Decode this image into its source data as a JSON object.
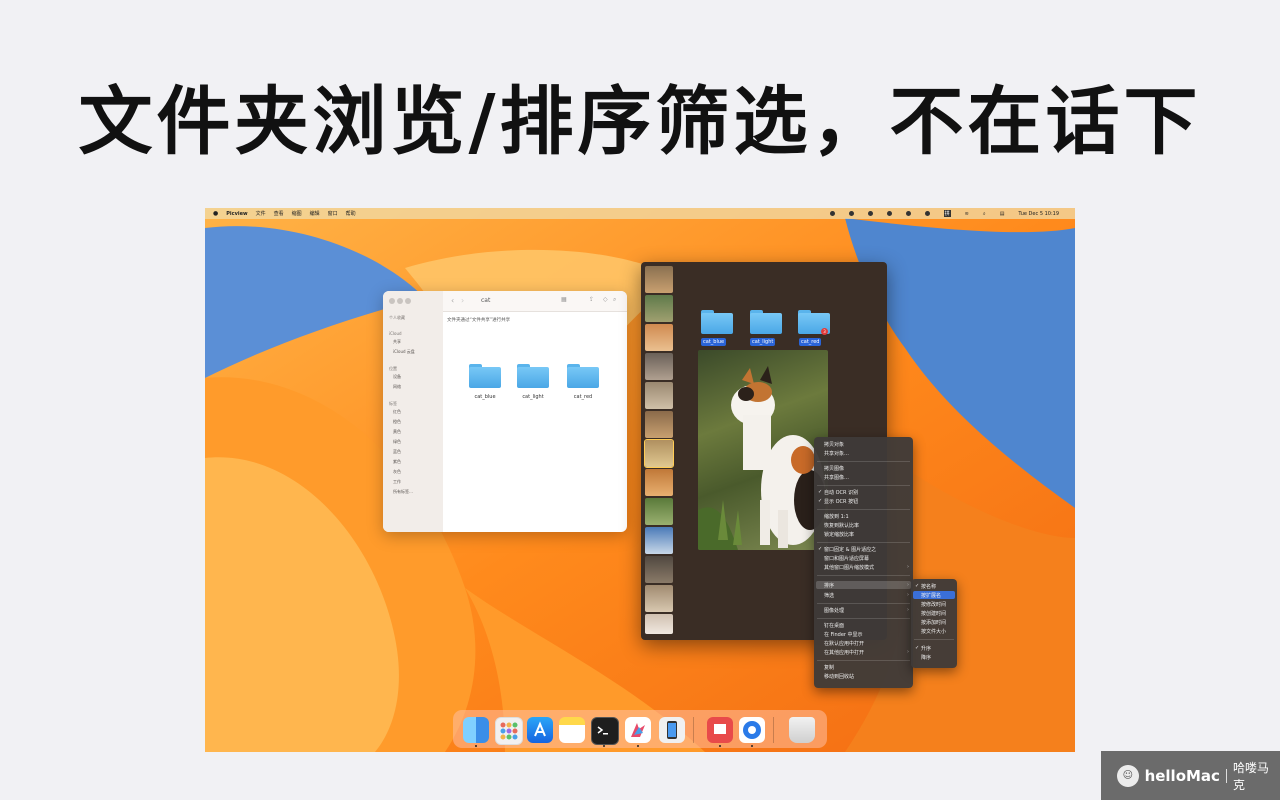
{
  "headline": "文件夹浏览/排序筛选，不在话下",
  "menubar": {
    "apple": "",
    "app_name": "Picview",
    "items": [
      "文件",
      "查看",
      "缩图",
      "编辑",
      "窗口",
      "帮助"
    ],
    "ime_label": "拼",
    "clock": "Tue Dec 5  10:19"
  },
  "finder": {
    "title": "cat",
    "info_text": "文件夹通过“文件共享”进行共享",
    "sidebar_sections": [
      {
        "label": "个人收藏",
        "items": []
      },
      {
        "label": "iCloud",
        "items": [
          "共享",
          "iCloud 云盘"
        ]
      },
      {
        "label": "位置",
        "items": [
          "设备",
          "网络"
        ]
      },
      {
        "label": "标签",
        "items": [
          "红色",
          "橙色",
          "黄色",
          "绿色",
          "蓝色",
          "紫色",
          "灰色",
          "工作",
          "所有标签…"
        ]
      }
    ],
    "folders": [
      "cat_blue",
      "cat_light",
      "cat_red"
    ]
  },
  "picview": {
    "folders": [
      "cat_blue",
      "cat_light",
      "cat_red"
    ],
    "badge": "3"
  },
  "context_menu": {
    "items": [
      {
        "label": "拷贝对象",
        "check": false,
        "arrow": false,
        "sep_before": false
      },
      {
        "label": "共享对象…",
        "check": false,
        "arrow": false,
        "sep_before": false
      },
      {
        "label": "拷贝图像",
        "check": false,
        "arrow": false,
        "sep_before": true
      },
      {
        "label": "共享图像…",
        "check": false,
        "arrow": false,
        "sep_before": false
      },
      {
        "label": "自动 OCR 识别",
        "check": true,
        "arrow": false,
        "sep_before": true
      },
      {
        "label": "显示 OCR 按钮",
        "check": true,
        "arrow": false,
        "sep_before": false
      },
      {
        "label": "缩放到 1:1",
        "check": false,
        "arrow": false,
        "sep_before": true
      },
      {
        "label": "恢复到默认比率",
        "check": false,
        "arrow": false,
        "sep_before": false
      },
      {
        "label": "锁定缩放比率",
        "check": false,
        "arrow": false,
        "sep_before": false
      },
      {
        "label": "窗口固定 & 图片适应之",
        "check": true,
        "arrow": false,
        "sep_before": true
      },
      {
        "label": "窗口和图片适应屏幕",
        "check": false,
        "arrow": false,
        "sep_before": false
      },
      {
        "label": "其他窗口图片缩放模式",
        "check": false,
        "arrow": true,
        "sep_before": false
      },
      {
        "label": "排序",
        "check": false,
        "arrow": true,
        "sep_before": true
      },
      {
        "label": "筛选",
        "check": false,
        "arrow": true,
        "sep_before": false
      },
      {
        "label": "图像处理",
        "check": false,
        "arrow": true,
        "sep_before": true
      },
      {
        "label": "钉在桌面",
        "check": false,
        "arrow": false,
        "sep_before": true
      },
      {
        "label": "在 Finder 中显示",
        "check": false,
        "arrow": false,
        "sep_before": false
      },
      {
        "label": "在默认应用中打开",
        "check": false,
        "arrow": false,
        "sep_before": false
      },
      {
        "label": "在其他应用中打开",
        "check": false,
        "arrow": true,
        "sep_before": false
      },
      {
        "label": "复制",
        "check": false,
        "arrow": false,
        "sep_before": true
      },
      {
        "label": "移动到回收站",
        "check": false,
        "arrow": false,
        "sep_before": false
      }
    ]
  },
  "sort_submenu": {
    "items": [
      {
        "label": "按名称",
        "check": true,
        "highlight": false
      },
      {
        "label": "按扩展名",
        "check": false,
        "highlight": true
      },
      {
        "label": "按修改时间",
        "check": false,
        "highlight": false
      },
      {
        "label": "按创建时间",
        "check": false,
        "highlight": false
      },
      {
        "label": "按添加时间",
        "check": false,
        "highlight": false
      },
      {
        "label": "按文件大小",
        "check": false,
        "highlight": false
      },
      {
        "label": "升序",
        "check": true,
        "highlight": false,
        "sep_before": true
      },
      {
        "label": "降序",
        "check": false,
        "highlight": false
      }
    ]
  },
  "dock": {
    "apps": [
      "finder-icon",
      "launchpad-icon",
      "app-store-icon",
      "notes-icon",
      "terminal-icon",
      "picview-icon",
      "simulator-icon",
      "slides-icon",
      "safari-like-icon",
      "trash-icon"
    ]
  },
  "watermark": {
    "brand": "helloMac",
    "cn": "哈喽马克"
  },
  "colors": {
    "accent_blue": "#2a64d8",
    "folder_blue": "#5ab4ec",
    "picview_bg": "#3a2d25",
    "menu_bg": "#3e3a38"
  }
}
